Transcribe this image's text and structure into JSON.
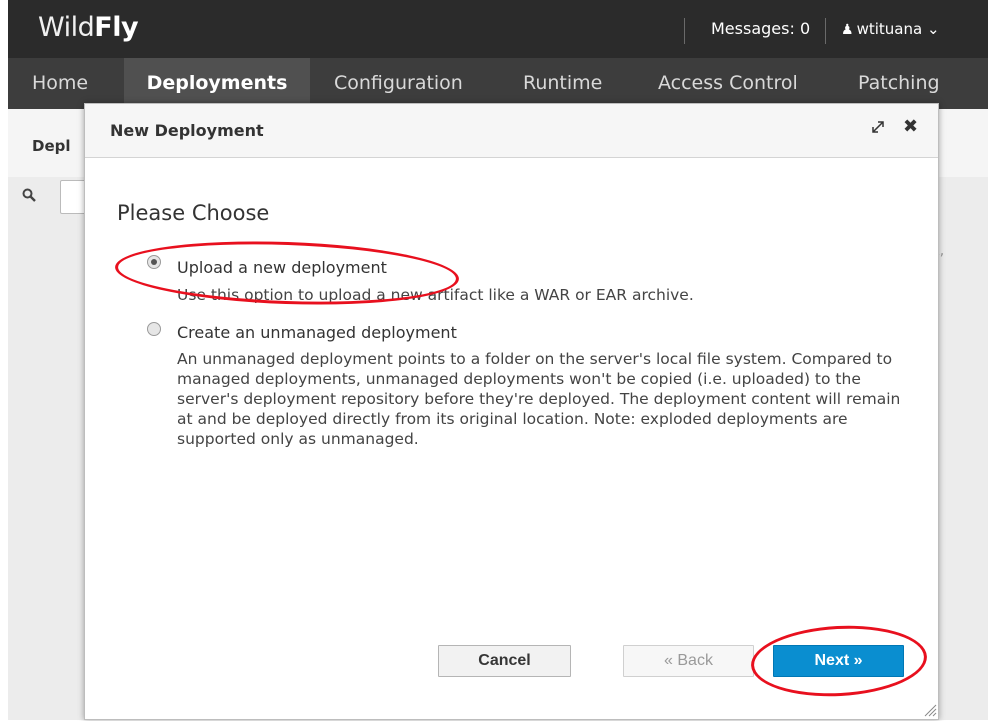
{
  "app": {
    "logo_prefix": "Wild",
    "logo_suffix": "Fly"
  },
  "header": {
    "messages": "Messages: 0",
    "user": "wtituana",
    "user_chevron": "⌄"
  },
  "nav": {
    "items": [
      {
        "label": "Home"
      },
      {
        "label": "Deployments"
      },
      {
        "label": "Configuration"
      },
      {
        "label": "Runtime"
      },
      {
        "label": "Access Control"
      },
      {
        "label": "Patching"
      }
    ]
  },
  "background": {
    "subtitle": "Depl",
    "right_fragment": "R,"
  },
  "modal": {
    "title": "New Deployment",
    "heading": "Please Choose",
    "options": [
      {
        "label": "Upload a new deployment",
        "description": "Use this option to upload a new artifact like a WAR or EAR archive.",
        "selected": true
      },
      {
        "label": "Create an unmanaged deployment",
        "description": "An unmanaged deployment points to a folder on the server's local file system. Compared to managed deployments, unmanaged deployments won't be copied (i.e. uploaded) to the server's deployment repository before they're deployed. The deployment content will remain at and be deployed directly from its original location. Note: exploded deployments are supported only as unmanaged.",
        "selected": false
      }
    ],
    "buttons": {
      "cancel": "Cancel",
      "back": "« Back",
      "next": "Next »"
    }
  },
  "icons": {
    "search": "search-icon",
    "user": "user-icon",
    "maximize": "maximize-icon",
    "close": "close-icon"
  },
  "colors": {
    "topbar": "#2b2b2b",
    "navbar": "#3d3d3d",
    "primary_button": "#0a8ed0",
    "annotation": "#e8101e"
  }
}
